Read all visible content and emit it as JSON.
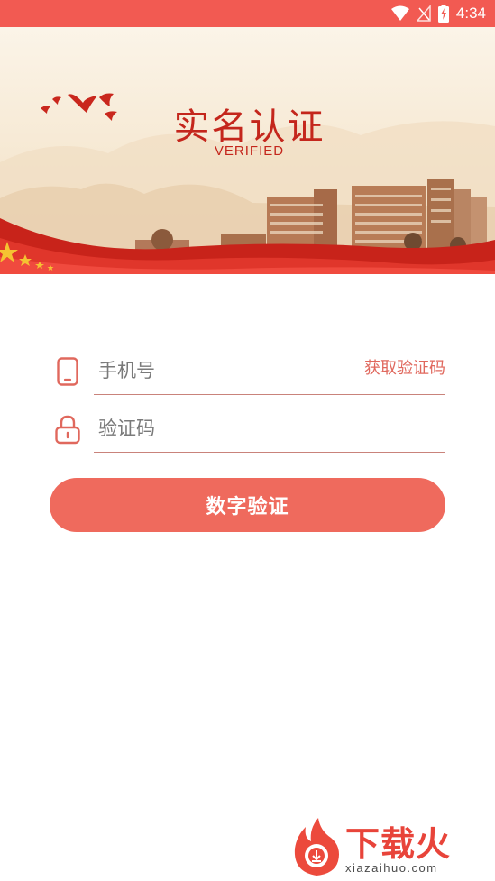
{
  "status_bar": {
    "time": "4:34",
    "icons": [
      "wifi-icon",
      "signal-icon",
      "battery-charging-icon"
    ],
    "background": "#f25a52"
  },
  "banner": {
    "title": "实名认证",
    "subtitle": "VERIFIED",
    "accent": "#c4261c"
  },
  "form": {
    "phone": {
      "placeholder": "手机号",
      "value": ""
    },
    "get_code_label": "获取验证码",
    "code": {
      "placeholder": "验证码",
      "value": ""
    },
    "submit_label": "数字验证",
    "button_color": "#ef6a5d"
  },
  "watermark": {
    "text": "下载火",
    "url": "xiazaihuo.com"
  }
}
